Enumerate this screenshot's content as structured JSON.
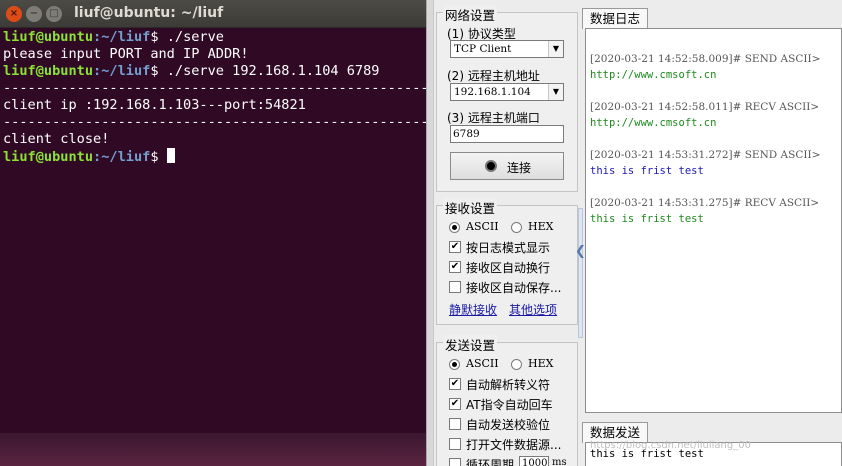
{
  "terminal": {
    "title": "liuf@ubuntu: ~/liuf",
    "close_glyph": "×",
    "min_glyph": "−",
    "max_glyph": "□",
    "user_host": "liuf@ubuntu",
    "path": ":~/liuf",
    "dollar": "$",
    "lines": [
      {
        "kind": "prompt",
        "cmd": " ./serve"
      },
      {
        "kind": "out",
        "text": "please input PORT and IP ADDR!"
      },
      {
        "kind": "prompt",
        "cmd": " ./serve 192.168.1.104 6789"
      },
      {
        "kind": "out",
        "text": "------------------------------------------------------------"
      },
      {
        "kind": "out",
        "text": "client ip :192.168.1.103---port:54821"
      },
      {
        "kind": "out",
        "text": "------------------------------------------------------------"
      },
      {
        "kind": "out",
        "text": "client close!"
      },
      {
        "kind": "prompt",
        "cmd": " "
      }
    ]
  },
  "network": {
    "title": "网络设置",
    "protocol_label": "(1) 协议类型",
    "protocol_value": "TCP Client",
    "host_label": "(2) 远程主机地址",
    "host_value": "192.168.1.104",
    "port_label": "(3) 远程主机端口",
    "port_value": "6789",
    "connect_label": "连接",
    "dropdown_glyph": "▼"
  },
  "receive": {
    "title": "接收设置",
    "ascii": "ASCII",
    "hex": "HEX",
    "check_glyph": "✔",
    "opt1": "按日志模式显示",
    "opt2": "接收区自动换行",
    "opt3": "接收区自动保存...",
    "link1": "静默接收",
    "link2": "其他选项"
  },
  "send": {
    "title": "发送设置",
    "ascii": "ASCII",
    "hex": "HEX",
    "opt1": "自动解析转义符",
    "opt2": "AT指令自动回车",
    "opt3": "自动发送校验位",
    "opt4": "打开文件数据源...",
    "opt5": "循环周期",
    "period": "1000",
    "unit": "ms"
  },
  "collapse_glyph": "❮",
  "log": {
    "tab": "数据日志",
    "entries": [
      {
        "head": "[2020-03-21 14:52:58.009]# SEND ASCII>",
        "body": "http://www.cmsoft.cn",
        "kind": "link"
      },
      {
        "head": "[2020-03-21 14:52:58.011]# RECV ASCII>",
        "body": "http://www.cmsoft.cn",
        "kind": "link"
      },
      {
        "head": "[2020-03-21 14:53:31.272]# SEND ASCII>",
        "body": "this is frist test",
        "kind": "send"
      },
      {
        "head": "[2020-03-21 14:53:31.275]# RECV ASCII>",
        "body": "this is frist test",
        "kind": "recv"
      }
    ]
  },
  "send_area": {
    "tab": "数据发送",
    "text": "this is frist test"
  },
  "watermark": "https://blog.csdn.net/liuliang_00"
}
